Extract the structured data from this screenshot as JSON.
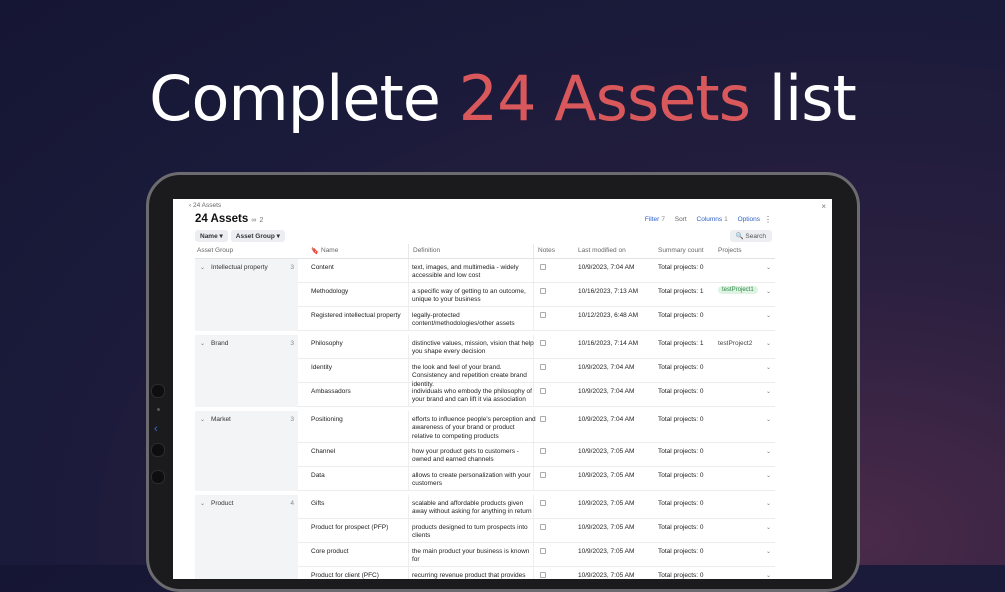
{
  "headline": {
    "pre": "Complete ",
    "accent": "24 Assets",
    "post": " list"
  },
  "colors": {
    "accent": "#d9585c",
    "link": "#2b5fc7",
    "badge_bg": "#dff3e3",
    "badge_text": "#2d8a4a"
  },
  "app": {
    "breadcrumb": "‹  24 Assets",
    "close": "×",
    "title": "24 Assets",
    "title_icon": "∞",
    "title_count": "2",
    "toolbar": {
      "filter": "Filter",
      "filter_count": "7",
      "sort": "Sort",
      "columns": "Columns",
      "columns_count": "1",
      "options": "Options",
      "more": "⋮"
    },
    "chips": [
      "Name ▾",
      "Asset Group ▾"
    ],
    "search": "🔍 Search",
    "columns": [
      "Asset Group",
      "Name",
      "Definition",
      "Notes",
      "Last modified on",
      "Summary count",
      "Projects"
    ],
    "name_icon": "🔖"
  },
  "groups": [
    {
      "name": "Intellectual property",
      "count": "3",
      "rows": [
        {
          "name": "Content",
          "definition": "text, images, and multimedia - widely accessible and low cost",
          "modified": "10/9/2023, 7:04 AM",
          "summary": "Total projects: 0",
          "project": ""
        },
        {
          "name": "Methodology",
          "definition": "a specific way of getting to an outcome, unique to your business",
          "modified": "10/16/2023, 7:13 AM",
          "summary": "Total projects: 1",
          "project": "testProject1",
          "badge": true
        },
        {
          "name": "Registered intellectual property",
          "definition": "legally-protected content/methodologies/other assets",
          "modified": "10/12/2023, 6:48 AM",
          "summary": "Total projects: 0",
          "project": ""
        }
      ]
    },
    {
      "name": "Brand",
      "count": "3",
      "rows": [
        {
          "name": "Philosophy",
          "definition": "distinctive values, mission, vision that help you shape every decision",
          "modified": "10/16/2023, 7:14 AM",
          "summary": "Total projects: 1",
          "project": "testProject2"
        },
        {
          "name": "Identity",
          "definition": "the look and feel of your brand. Consistency and repetition create brand identity.",
          "modified": "10/9/2023, 7:04 AM",
          "summary": "Total projects: 0",
          "project": ""
        },
        {
          "name": "Ambassadors",
          "definition": "individuals who embody the philosophy of your brand and can lift it via association",
          "modified": "10/9/2023, 7:04 AM",
          "summary": "Total projects: 0",
          "project": ""
        }
      ]
    },
    {
      "name": "Market",
      "count": "3",
      "rows": [
        {
          "name": "Positioning",
          "definition": "efforts to influence people's perception and awareness of your brand or product relative to competing products",
          "modified": "10/9/2023, 7:04 AM",
          "summary": "Total projects: 0",
          "project": ""
        },
        {
          "name": "Channel",
          "definition": "how your product gets to customers - owned and earned channels",
          "modified": "10/9/2023, 7:05 AM",
          "summary": "Total projects: 0",
          "project": ""
        },
        {
          "name": "Data",
          "definition": "allows to create personalization with your customers",
          "modified": "10/9/2023, 7:05 AM",
          "summary": "Total projects: 0",
          "project": ""
        }
      ]
    },
    {
      "name": "Product",
      "count": "4",
      "rows": [
        {
          "name": "Gifts",
          "definition": "scalable and affordable products given away without asking for anything in return",
          "modified": "10/9/2023, 7:05 AM",
          "summary": "Total projects: 0",
          "project": ""
        },
        {
          "name": "Product for prospect (PFP)",
          "definition": "products designed to turn prospects into clients",
          "modified": "10/9/2023, 7:05 AM",
          "summary": "Total projects: 0",
          "project": ""
        },
        {
          "name": "Core product",
          "definition": "the main product your business is known for",
          "modified": "10/9/2023, 7:05 AM",
          "summary": "Total projects: 0",
          "project": ""
        },
        {
          "name": "Product for client (PFC)",
          "definition": "recurring revenue product that provides value",
          "modified": "10/9/2023, 7:05 AM",
          "summary": "Total projects: 0",
          "project": ""
        }
      ]
    }
  ],
  "icons": {
    "note": "note-icon",
    "row_chevron": "⌄",
    "group_chevron": "⌄"
  }
}
